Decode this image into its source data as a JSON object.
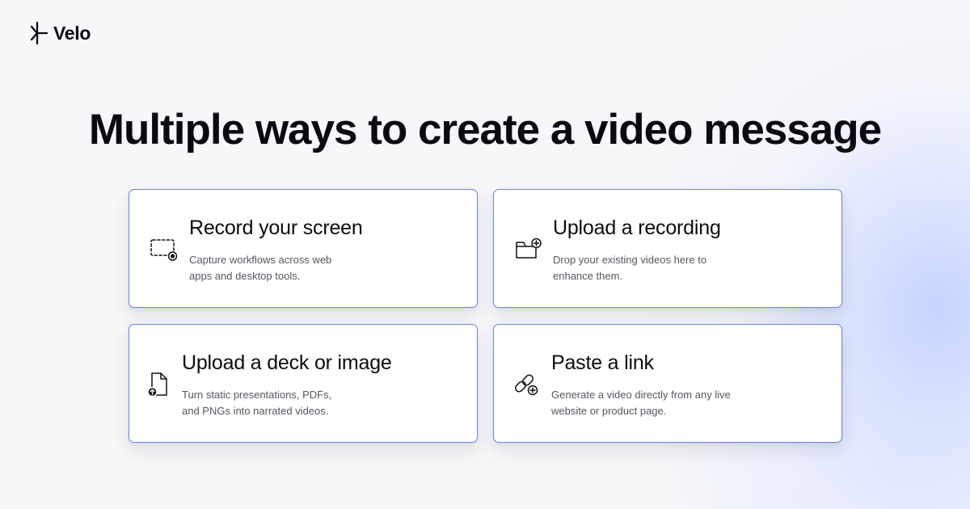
{
  "brand": {
    "name": "Velo",
    "logo_icon": "velo-logo-icon"
  },
  "headline": "Multiple ways to create a video message",
  "colors": {
    "card_border": "#6a83e6",
    "text_primary": "#0c0c12",
    "text_secondary": "#55575f",
    "background": "#f7f7f9",
    "glow": "#c4d2ff"
  },
  "cards": [
    {
      "icon": "screen-record-icon",
      "title": "Record your screen",
      "desc_lines": [
        "Capture workflows across web",
        "apps and desktop tools."
      ]
    },
    {
      "icon": "folder-add-icon",
      "title": "Upload a recording",
      "desc_lines": [
        "Drop your existing videos here to",
        "enhance them."
      ]
    },
    {
      "icon": "file-upload-icon",
      "title": "Upload a deck or image",
      "desc_lines": [
        "Turn static presentations, PDFs,",
        "and PNGs into narrated videos."
      ]
    },
    {
      "icon": "link-add-icon",
      "title": "Paste a link",
      "desc_lines": [
        "Generate a video directly from any live",
        "website or product page."
      ]
    }
  ]
}
